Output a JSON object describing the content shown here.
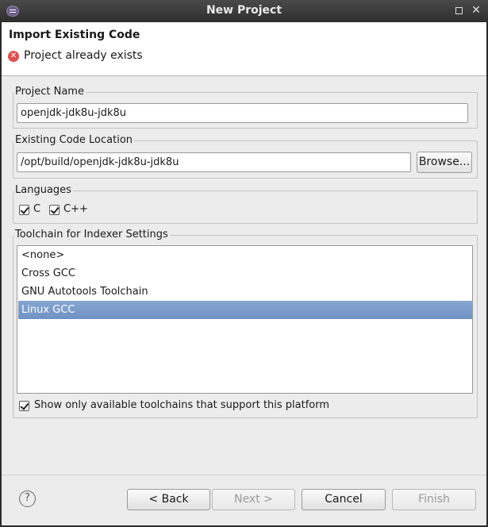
{
  "window": {
    "title": "New Project"
  },
  "header": {
    "title": "Import Existing Code",
    "error_icon": "error-icon",
    "error_message": "Project already exists"
  },
  "project_name": {
    "label": "Project Name",
    "value": "openjdk-jdk8u-jdk8u"
  },
  "code_location": {
    "label": "Existing Code Location",
    "value": "/opt/build/openjdk-jdk8u-jdk8u",
    "browse_label": "Browse..."
  },
  "languages": {
    "label": "Languages",
    "items": [
      {
        "label": "C",
        "checked": true
      },
      {
        "label": "C++",
        "checked": true
      }
    ]
  },
  "toolchain": {
    "label": "Toolchain for Indexer Settings",
    "items": [
      {
        "label": "<none>",
        "selected": false
      },
      {
        "label": "Cross GCC",
        "selected": false
      },
      {
        "label": "GNU Autotools Toolchain",
        "selected": false
      },
      {
        "label": "Linux GCC",
        "selected": true
      }
    ],
    "show_only_label": "Show only available toolchains that support this platform",
    "show_only_checked": true
  },
  "footer": {
    "help_icon": "help-icon",
    "back_label": "< Back",
    "next_label": "Next >",
    "cancel_label": "Cancel",
    "finish_label": "Finish"
  },
  "colors": {
    "selection": "#7799c9",
    "error": "#e05050"
  }
}
